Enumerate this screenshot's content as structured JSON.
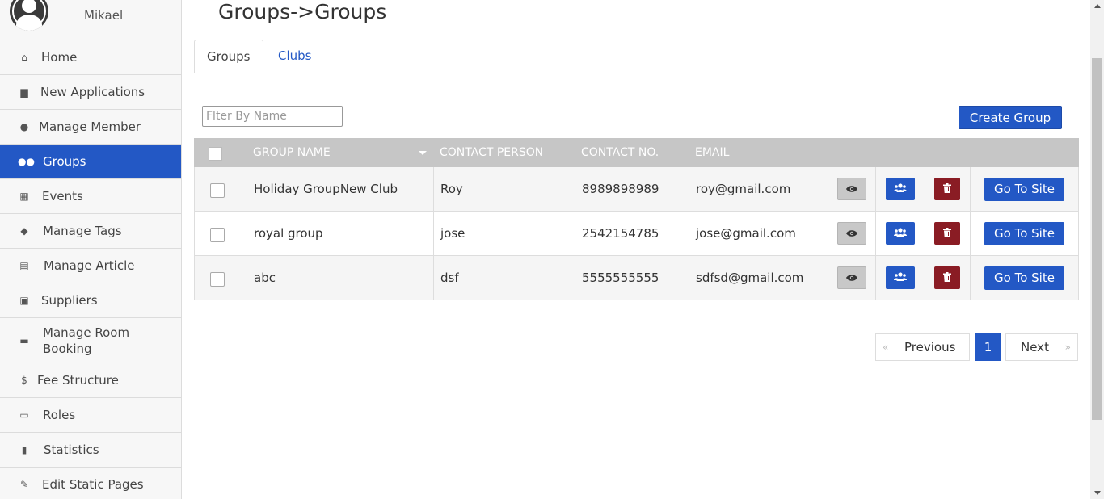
{
  "user": {
    "name": "Mikael"
  },
  "sidebar": {
    "items": [
      {
        "label": "Home",
        "icon": "home-icon",
        "glyph": "⌂"
      },
      {
        "label": "New Applications",
        "icon": "file-icon",
        "glyph": "▆"
      },
      {
        "label": "Manage Member",
        "icon": "user-icon",
        "glyph": "●"
      },
      {
        "label": "Groups",
        "icon": "users-icon",
        "glyph": "●●",
        "active": true
      },
      {
        "label": "Events",
        "icon": "calendar-icon",
        "glyph": "▦"
      },
      {
        "label": "Manage Tags",
        "icon": "tags-icon",
        "glyph": "◆"
      },
      {
        "label": "Manage Article",
        "icon": "newspaper-icon",
        "glyph": "▤"
      },
      {
        "label": "Suppliers",
        "icon": "suppliers-icon",
        "glyph": "▣"
      },
      {
        "label": "Manage Room Booking",
        "icon": "bed-icon",
        "glyph": "▬"
      },
      {
        "label": "Fee Structure",
        "icon": "dollar-icon",
        "glyph": "$"
      },
      {
        "label": "Roles",
        "icon": "id-card-icon",
        "glyph": "▭"
      },
      {
        "label": "Statistics",
        "icon": "bar-chart-icon",
        "glyph": "▮"
      },
      {
        "label": "Edit Static Pages",
        "icon": "edit-icon",
        "glyph": "✎"
      }
    ]
  },
  "page": {
    "title": "Groups->Groups"
  },
  "tabs": [
    {
      "label": "Groups",
      "active": true
    },
    {
      "label": "Clubs",
      "active": false
    }
  ],
  "filter": {
    "placeholder": "Flter By Name",
    "value": ""
  },
  "create_button": "Create Group",
  "table": {
    "headers": [
      "GROUP NAME",
      "CONTACT PERSON",
      "CONTACT NO.",
      "EMAIL"
    ],
    "rows": [
      {
        "name": "Holiday GroupNew Club",
        "contact": "Roy",
        "phone": "8989898989",
        "email": "roy@gmail.com",
        "site": "Go To Site"
      },
      {
        "name": "royal group",
        "contact": "jose",
        "phone": "2542154785",
        "email": "jose@gmail.com",
        "site": "Go To Site"
      },
      {
        "name": "abc",
        "contact": "dsf",
        "phone": "5555555555",
        "email": "sdfsd@gmail.com",
        "site": "Go To Site"
      }
    ]
  },
  "pagination": {
    "prev": "Previous",
    "current": "1",
    "next": "Next",
    "prev_guill": "«",
    "next_guill": "»"
  },
  "colors": {
    "primary": "#2358c5",
    "danger": "#8a1c24",
    "header": "#c6c6c6"
  }
}
